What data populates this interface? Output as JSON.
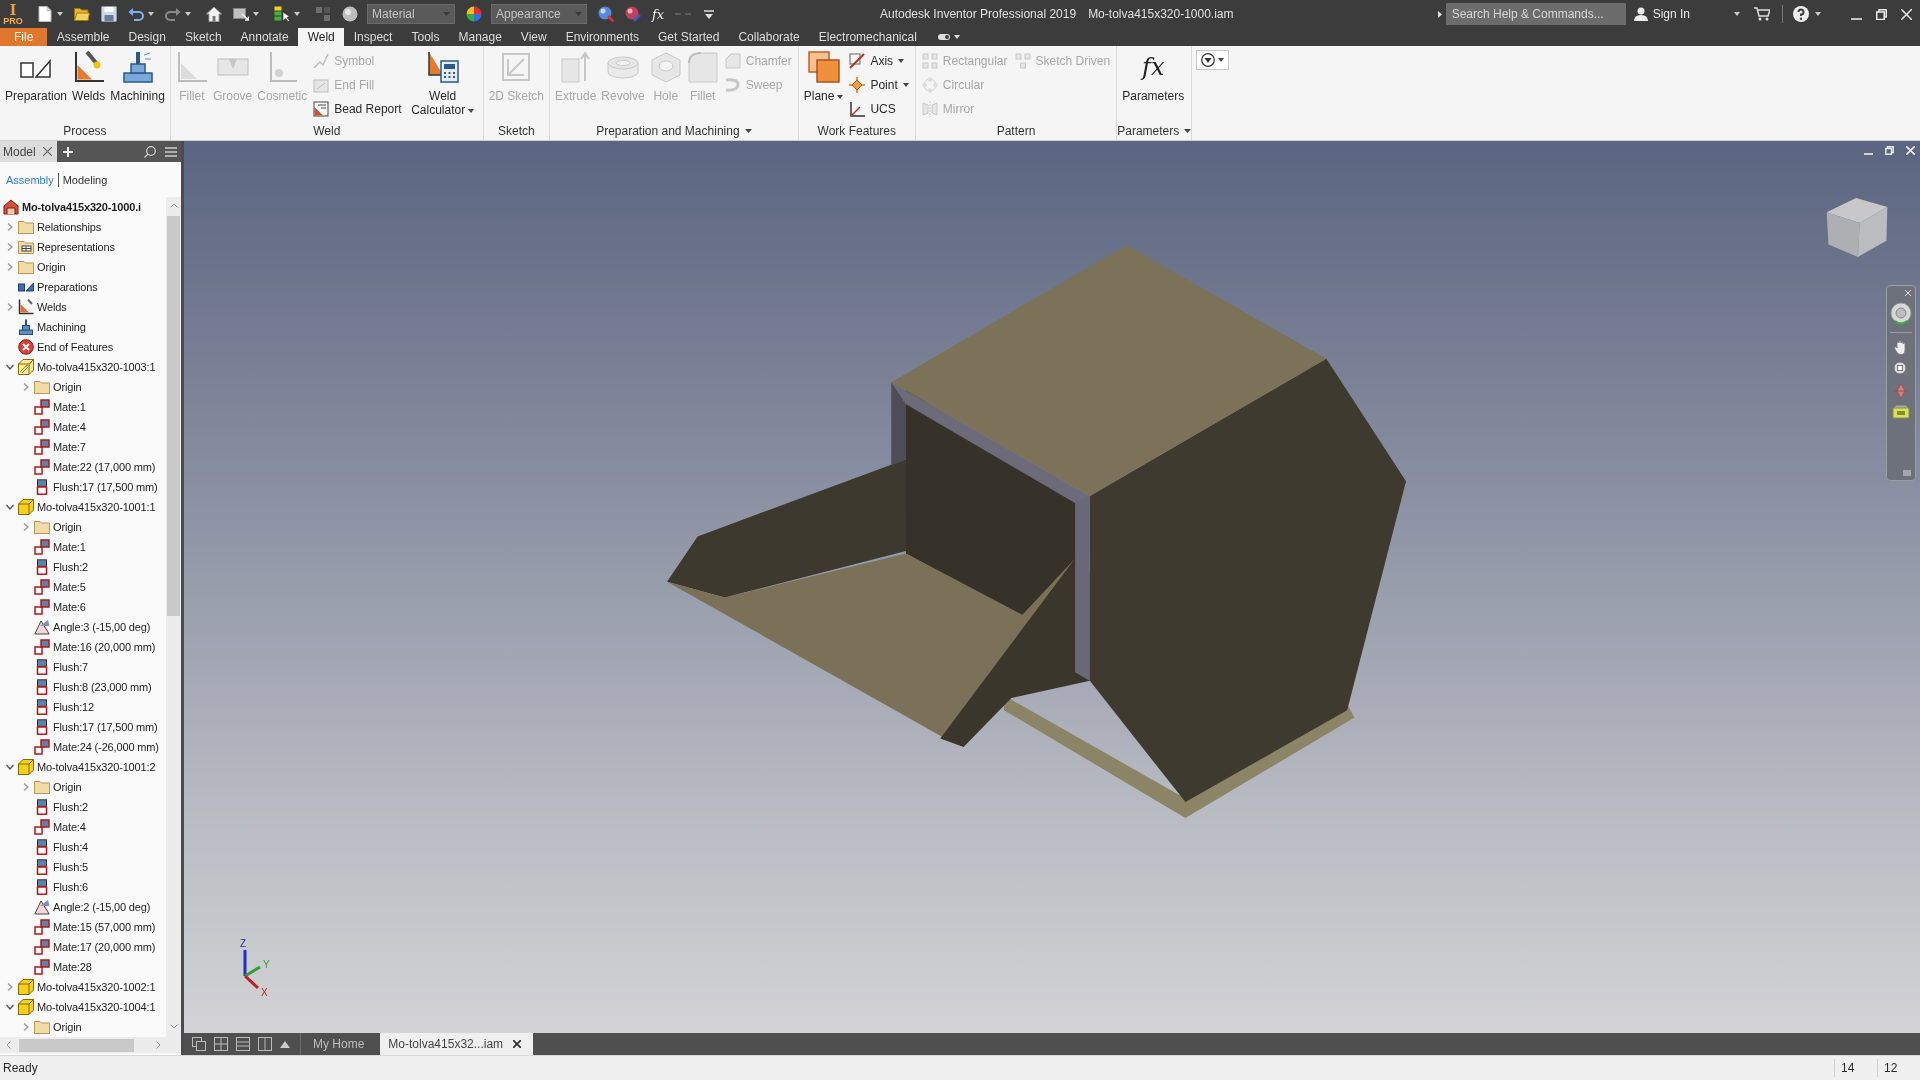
{
  "title_bar": {
    "logo": {
      "letter": "I",
      "badge": "PRO"
    },
    "material": {
      "value": "Material",
      "disabled": true
    },
    "appearance": {
      "value": "Appearance",
      "disabled": true
    },
    "formula": "fx",
    "app_title": "Autodesk Inventor Professional 2019",
    "document": "Mo-tolva415x320-1000.iam",
    "search": {
      "placeholder": "Search Help & Commands..."
    },
    "sign_in": "Sign In"
  },
  "ribbon": {
    "tabs": [
      {
        "label": "File",
        "kind": "file",
        "selected": false
      },
      {
        "label": "Assemble",
        "kind": "tab",
        "selected": false
      },
      {
        "label": "Design",
        "kind": "tab",
        "selected": false
      },
      {
        "label": "Sketch",
        "kind": "tab",
        "selected": false
      },
      {
        "label": "Annotate",
        "kind": "tab",
        "selected": false
      },
      {
        "label": "Weld",
        "kind": "tab",
        "selected": true
      },
      {
        "label": "Inspect",
        "kind": "tab",
        "selected": false
      },
      {
        "label": "Tools",
        "kind": "tab",
        "selected": false
      },
      {
        "label": "Manage",
        "kind": "tab",
        "selected": false
      },
      {
        "label": "View",
        "kind": "tab",
        "selected": false
      },
      {
        "label": "Environments",
        "kind": "tab",
        "selected": false
      },
      {
        "label": "Get Started",
        "kind": "tab",
        "selected": false
      },
      {
        "label": "Collaborate",
        "kind": "tab",
        "selected": false
      },
      {
        "label": "Electromechanical",
        "kind": "tab",
        "selected": false
      }
    ],
    "panels": [
      {
        "title": "Process",
        "menu": false,
        "groups": [
          {
            "kind": "large",
            "tools": [
              {
                "label": "Preparation",
                "disabled": false,
                "dropdown": false
              },
              {
                "label": "Welds",
                "disabled": false,
                "dropdown": false
              },
              {
                "label": "Machining",
                "disabled": false,
                "dropdown": false
              }
            ]
          }
        ]
      },
      {
        "title": "Weld",
        "menu": false,
        "groups": [
          {
            "kind": "large",
            "tools": [
              {
                "label": "Fillet",
                "disabled": true,
                "dropdown": false
              },
              {
                "label": "Groove",
                "disabled": true,
                "dropdown": false
              },
              {
                "label": "Cosmetic",
                "disabled": true,
                "dropdown": false
              }
            ]
          },
          {
            "kind": "stack",
            "tools": [
              {
                "label": "Symbol",
                "disabled": true,
                "dropdown": false
              },
              {
                "label": "End Fill",
                "disabled": true,
                "dropdown": false
              },
              {
                "label": "Bead Report",
                "disabled": false,
                "dropdown": false
              }
            ]
          },
          {
            "kind": "large",
            "tools": [
              {
                "label": "Weld Calculator",
                "disabled": false,
                "dropdown": true
              }
            ]
          }
        ]
      },
      {
        "title": "Sketch",
        "menu": false,
        "groups": [
          {
            "kind": "large",
            "tools": [
              {
                "label": "2D Sketch",
                "disabled": true,
                "dropdown": false
              }
            ]
          }
        ]
      },
      {
        "title": "Preparation and Machining",
        "menu": true,
        "groups": [
          {
            "kind": "large",
            "tools": [
              {
                "label": "Extrude",
                "disabled": true,
                "dropdown": false
              },
              {
                "label": "Revolve",
                "disabled": true,
                "dropdown": false
              },
              {
                "label": "Hole",
                "disabled": true,
                "dropdown": false
              },
              {
                "label": "Fillet",
                "disabled": true,
                "dropdown": false
              }
            ]
          },
          {
            "kind": "stack",
            "tools": [
              {
                "label": "Chamfer",
                "disabled": true,
                "dropdown": false
              },
              {
                "label": "Sweep",
                "disabled": true,
                "dropdown": false
              }
            ]
          }
        ]
      },
      {
        "title": "Work Features",
        "menu": false,
        "groups": [
          {
            "kind": "large",
            "tools": [
              {
                "label": "Plane",
                "disabled": false,
                "dropdown": true
              }
            ]
          },
          {
            "kind": "stack",
            "tools": [
              {
                "label": "Axis",
                "disabled": false,
                "dropdown": true
              },
              {
                "label": "Point",
                "disabled": false,
                "dropdown": true
              },
              {
                "label": "UCS",
                "disabled": false,
                "dropdown": false
              }
            ]
          }
        ]
      },
      {
        "title": "Pattern",
        "menu": false,
        "groups": [
          {
            "kind": "stack",
            "tools": [
              {
                "label": "Rectangular",
                "disabled": true,
                "dropdown": false
              },
              {
                "label": "Circular",
                "disabled": true,
                "dropdown": false
              },
              {
                "label": "Mirror",
                "disabled": true,
                "dropdown": false
              }
            ]
          },
          {
            "kind": "stack",
            "tools": [
              {
                "label": "Sketch Driven",
                "disabled": true,
                "dropdown": false
              }
            ]
          }
        ]
      },
      {
        "title": "Parameters",
        "menu": true,
        "groups": [
          {
            "kind": "large",
            "tools": [
              {
                "label": "Parameters",
                "glyph": "fx",
                "disabled": false,
                "dropdown": false
              }
            ]
          }
        ]
      }
    ]
  },
  "browser": {
    "tab": "Model",
    "views": [
      {
        "label": "Assembly",
        "selected": true
      },
      {
        "label": "Modeling",
        "selected": false
      }
    ],
    "tree": {
      "label": "Mo-tolva415x320-1000.i",
      "kind": "assembly",
      "children": [
        {
          "label": "Relationships",
          "kind": "folder",
          "expanded": false
        },
        {
          "label": "Representations",
          "kind": "representations",
          "expanded": false
        },
        {
          "label": "Origin",
          "kind": "folder",
          "expanded": false
        },
        {
          "label": "Preparations",
          "kind": "preparations"
        },
        {
          "label": "Welds",
          "kind": "welds",
          "expanded": false
        },
        {
          "label": "Machining",
          "kind": "machining"
        },
        {
          "label": "End of Features",
          "kind": "end"
        },
        {
          "label": "Mo-tolva415x320-1003:1",
          "kind": "weldment",
          "expanded": true,
          "children": [
            {
              "label": "Origin",
              "kind": "folder",
              "expanded": false
            },
            {
              "label": "Mate:1",
              "kind": "mate"
            },
            {
              "label": "Mate:4",
              "kind": "mate"
            },
            {
              "label": "Mate:7",
              "kind": "mate"
            },
            {
              "label": "Mate:22 (17,000 mm)",
              "kind": "mate"
            },
            {
              "label": "Flush:17 (17,500 mm)",
              "kind": "flush"
            }
          ]
        },
        {
          "label": "Mo-tolva415x320-1001:1",
          "kind": "part",
          "expanded": true,
          "children": [
            {
              "label": "Origin",
              "kind": "folder",
              "expanded": false
            },
            {
              "label": "Mate:1",
              "kind": "mate"
            },
            {
              "label": "Flush:2",
              "kind": "flush"
            },
            {
              "label": "Mate:5",
              "kind": "mate"
            },
            {
              "label": "Mate:6",
              "kind": "mate"
            },
            {
              "label": "Angle:3 (-15,00 deg)",
              "kind": "angle"
            },
            {
              "label": "Mate:16 (20,000 mm)",
              "kind": "mate"
            },
            {
              "label": "Flush:7",
              "kind": "flush"
            },
            {
              "label": "Flush:8 (23,000 mm)",
              "kind": "flush"
            },
            {
              "label": "Flush:12",
              "kind": "flush"
            },
            {
              "label": "Flush:17 (17,500 mm)",
              "kind": "flush"
            },
            {
              "label": "Mate:24 (-26,000 mm)",
              "kind": "mate"
            }
          ]
        },
        {
          "label": "Mo-tolva415x320-1001:2",
          "kind": "part",
          "expanded": true,
          "children": [
            {
              "label": "Origin",
              "kind": "folder",
              "expanded": false
            },
            {
              "label": "Flush:2",
              "kind": "flush"
            },
            {
              "label": "Mate:4",
              "kind": "mate"
            },
            {
              "label": "Flush:4",
              "kind": "flush"
            },
            {
              "label": "Flush:5",
              "kind": "flush"
            },
            {
              "label": "Flush:6",
              "kind": "flush"
            },
            {
              "label": "Angle:2 (-15,00 deg)",
              "kind": "angle"
            },
            {
              "label": "Mate:15 (57,000 mm)",
              "kind": "mate"
            },
            {
              "label": "Mate:17 (20,000 mm)",
              "kind": "mate"
            },
            {
              "label": "Mate:28",
              "kind": "mate"
            }
          ]
        },
        {
          "label": "Mo-tolva415x320-1002:1",
          "kind": "part",
          "expanded": false
        },
        {
          "label": "Mo-tolva415x320-1004:1",
          "kind": "part",
          "expanded": true,
          "children": [
            {
              "label": "Origin",
              "kind": "folder",
              "expanded": false
            }
          ]
        }
      ]
    }
  },
  "viewport": {
    "triad": {
      "x": "X",
      "y": "Y",
      "z": "Z"
    }
  },
  "document_tabs": [
    {
      "label": "My Home",
      "selected": false
    },
    {
      "label": "Mo-tolva415x32...iam",
      "selected": true
    }
  ],
  "status_bar": {
    "message": "Ready",
    "values": [
      "14",
      "12"
    ]
  }
}
